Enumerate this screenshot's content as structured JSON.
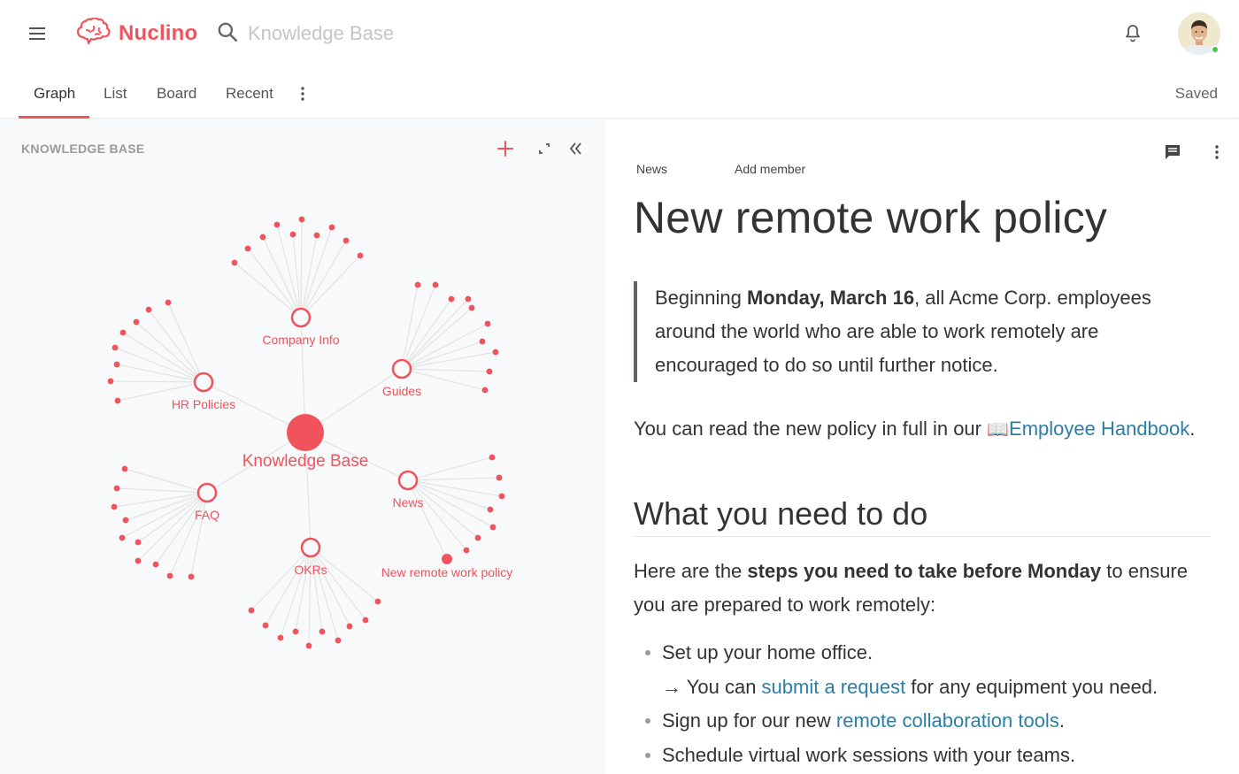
{
  "header": {
    "app_name": "Nuclino",
    "search_placeholder": "Knowledge Base"
  },
  "tabs": [
    {
      "label": "Graph"
    },
    {
      "label": "List"
    },
    {
      "label": "Board"
    },
    {
      "label": "Recent"
    }
  ],
  "status": "Saved",
  "left_panel": {
    "title": "KNOWLEDGE BASE"
  },
  "graph": {
    "root": "Knowledge Base",
    "clusters": [
      {
        "label": "Company Info"
      },
      {
        "label": "HR Policies"
      },
      {
        "label": "Guides"
      },
      {
        "label": "FAQ"
      },
      {
        "label": "News"
      },
      {
        "label": "OKRs"
      }
    ],
    "highlight_item": "New remote work policy"
  },
  "document": {
    "breadcrumb": "News",
    "add_member": "Add member",
    "title": "New remote work policy",
    "quote": {
      "pre": "Beginning ",
      "bold": "Monday, March 16",
      "post": ", all Acme Corp. employees around the world who are able to work remotely are encouraged to do so until further notice."
    },
    "handbook_para": {
      "pre": "You can read the new policy in full in our ",
      "emoji": "📖",
      "link": "Employee Handbook",
      "post": "."
    },
    "heading2": "What you need to do",
    "steps_para": {
      "pre": "Here are the ",
      "bold": "steps you need to take before Monday",
      "post": " to ensure you are prepared to work remotely:"
    },
    "bullets": {
      "b1": "Set up your home office.",
      "b1_sub_pre": "→  You can ",
      "b1_sub_link": "submit a request",
      "b1_sub_post": " for any equipment you need.",
      "b2_pre": "Sign up for our new ",
      "b2_link": "remote collaboration tools",
      "b2_post": ".",
      "b3": "Schedule virtual work sessions with your teams."
    }
  },
  "colors": {
    "brand": "#f0535c",
    "link": "#2a7fa6",
    "online": "#44c94a"
  },
  "icons": [
    "menu-icon",
    "brain-logo-icon",
    "search-icon",
    "bell-icon",
    "more-vertical-icon",
    "plus-icon",
    "expand-icon",
    "collapse-left-icon",
    "comment-icon"
  ]
}
